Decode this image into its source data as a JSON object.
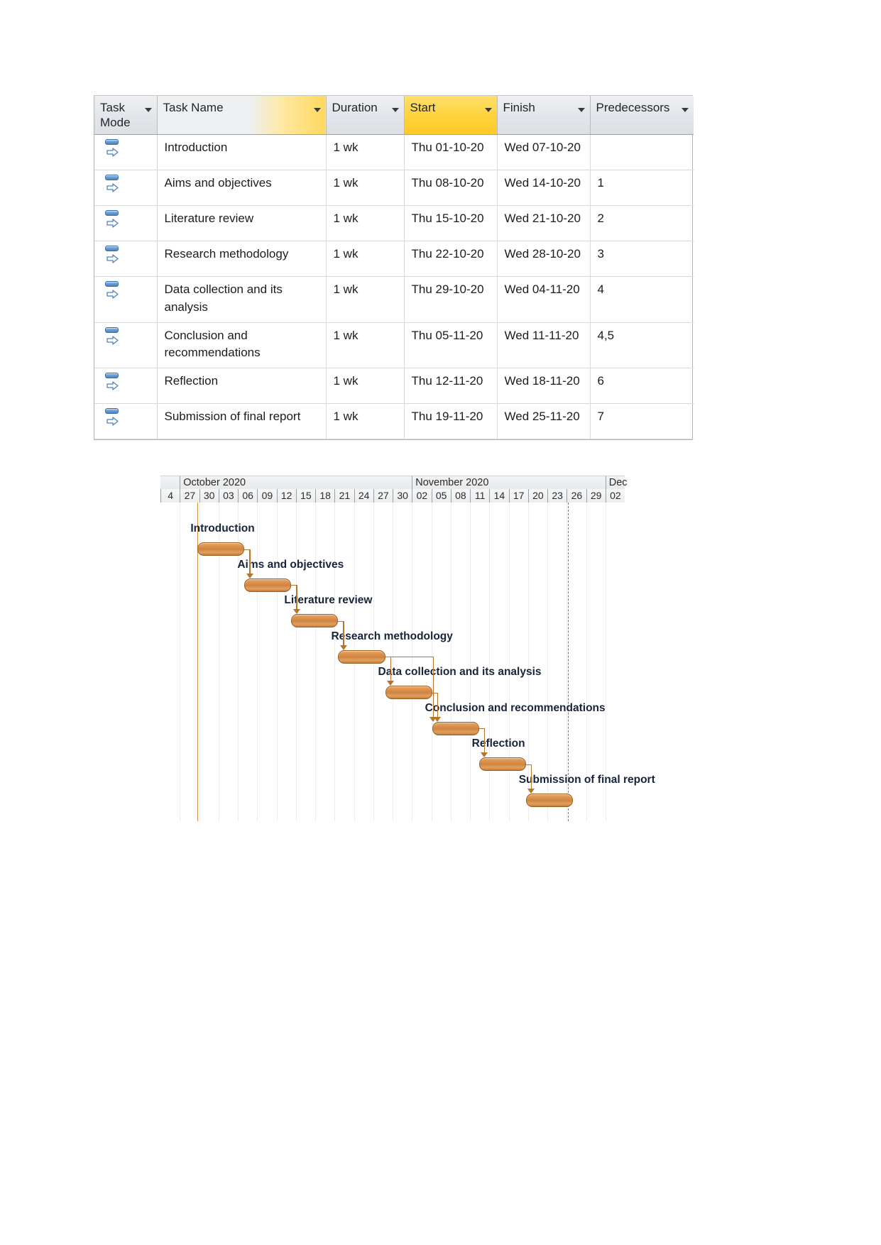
{
  "table": {
    "columns": [
      {
        "key": "mode",
        "label": "Task\nMode",
        "label_line1": "Task",
        "label_line2": "Mode",
        "highlighted": false
      },
      {
        "key": "name",
        "label": "Task Name",
        "highlighted": false
      },
      {
        "key": "dur",
        "label": "Duration",
        "highlighted": false
      },
      {
        "key": "start",
        "label": "Start",
        "highlighted": true
      },
      {
        "key": "finish",
        "label": "Finish",
        "highlighted": false
      },
      {
        "key": "pred",
        "label": "Predecessors",
        "highlighted": false
      }
    ],
    "rows": [
      {
        "id": 1,
        "mode_icon": "auto-schedule-icon",
        "name": "Introduction",
        "duration": "1 wk",
        "start": "Thu 01-10-20",
        "finish": "Wed 07-10-20",
        "predecessors": ""
      },
      {
        "id": 2,
        "mode_icon": "auto-schedule-icon",
        "name": "Aims and objectives",
        "duration": "1 wk",
        "start": "Thu 08-10-20",
        "finish": "Wed 14-10-20",
        "predecessors": "1"
      },
      {
        "id": 3,
        "mode_icon": "auto-schedule-icon",
        "name": "Literature review",
        "duration": "1 wk",
        "start": "Thu 15-10-20",
        "finish": "Wed 21-10-20",
        "predecessors": "2"
      },
      {
        "id": 4,
        "mode_icon": "auto-schedule-icon",
        "name": "Research methodology",
        "duration": "1 wk",
        "start": "Thu 22-10-20",
        "finish": "Wed 28-10-20",
        "predecessors": "3"
      },
      {
        "id": 5,
        "mode_icon": "auto-schedule-icon",
        "name": "Data collection and its analysis",
        "duration": "1 wk",
        "start": "Thu 29-10-20",
        "finish": "Wed 04-11-20",
        "predecessors": "4"
      },
      {
        "id": 6,
        "mode_icon": "auto-schedule-icon",
        "name": "Conclusion and recommendations",
        "duration": "1 wk",
        "start": "Thu 05-11-20",
        "finish": "Wed 11-11-20",
        "predecessors": "4,5"
      },
      {
        "id": 7,
        "mode_icon": "auto-schedule-icon",
        "name": "Reflection",
        "duration": "1 wk",
        "start": "Thu 12-11-20",
        "finish": "Wed 18-11-20",
        "predecessors": "6"
      },
      {
        "id": 8,
        "mode_icon": "auto-schedule-icon",
        "name": "Submission of final report",
        "duration": "1 wk",
        "start": "Thu 19-11-20",
        "finish": "Wed 25-11-20",
        "predecessors": "7"
      }
    ]
  },
  "chart_data": {
    "type": "bar",
    "subtype": "gantt",
    "title": "",
    "xlabel": "",
    "ylabel": "",
    "timescale": {
      "top_tier": [
        {
          "label": "October 2020",
          "start_day": "27",
          "span_ticks": 12
        },
        {
          "label": "November 2020",
          "start_day": "02",
          "span_ticks": 10
        },
        {
          "label": "Dec",
          "start_day": "29",
          "span_ticks": 2
        }
      ],
      "bottom_tier": [
        "4",
        "27",
        "30",
        "03",
        "06",
        "09",
        "12",
        "15",
        "18",
        "21",
        "24",
        "27",
        "30",
        "02",
        "05",
        "08",
        "11",
        "14",
        "17",
        "20",
        "23",
        "26",
        "29",
        "02"
      ],
      "tick_interval_days": 3
    },
    "categories": [
      "Introduction",
      "Aims and objectives",
      "Literature review",
      "Research methodology",
      "Data collection and its analysis",
      "Conclusion and recommendations",
      "Reflection",
      "Submission of final report"
    ],
    "bars": [
      {
        "name": "Introduction",
        "start": "Thu 01-10-20",
        "finish": "Wed 07-10-20",
        "duration": "1 wk",
        "x_pct": 8.0,
        "w_pct": 10.1,
        "row": 0
      },
      {
        "name": "Aims and objectives",
        "start": "Thu 08-10-20",
        "finish": "Wed 14-10-20",
        "duration": "1 wk",
        "x_pct": 18.1,
        "w_pct": 10.1,
        "row": 1
      },
      {
        "name": "Literature review",
        "start": "Thu 15-10-20",
        "finish": "Wed 21-10-20",
        "duration": "1 wk",
        "x_pct": 28.2,
        "w_pct": 10.1,
        "row": 2
      },
      {
        "name": "Research methodology",
        "start": "Thu 22-10-20",
        "finish": "Wed 28-10-20",
        "duration": "1 wk",
        "x_pct": 38.3,
        "w_pct": 10.1,
        "row": 3
      },
      {
        "name": "Data collection and its analysis",
        "start": "Thu 29-10-20",
        "finish": "Wed 04-11-20",
        "duration": "1 wk",
        "x_pct": 48.4,
        "w_pct": 10.1,
        "row": 4
      },
      {
        "name": "Conclusion and recommendations",
        "start": "Thu 05-11-20",
        "finish": "Wed 11-11-20",
        "duration": "1 wk",
        "x_pct": 58.5,
        "w_pct": 10.1,
        "row": 5
      },
      {
        "name": "Reflection",
        "start": "Thu 12-11-20",
        "finish": "Wed 18-11-20",
        "duration": "1 wk",
        "x_pct": 68.6,
        "w_pct": 10.1,
        "row": 6
      },
      {
        "name": "Submission of final report",
        "start": "Thu 19-11-20",
        "finish": "Wed 25-11-20",
        "duration": "1 wk",
        "x_pct": 78.7,
        "w_pct": 10.1,
        "row": 7
      }
    ],
    "links": [
      {
        "from": "Introduction",
        "to": "Aims and objectives",
        "type": "FS"
      },
      {
        "from": "Aims and objectives",
        "to": "Literature review",
        "type": "FS"
      },
      {
        "from": "Literature review",
        "to": "Research methodology",
        "type": "FS"
      },
      {
        "from": "Research methodology",
        "to": "Data collection and its analysis",
        "type": "FS"
      },
      {
        "from": "Data collection and its analysis",
        "to": "Conclusion and recommendations",
        "type": "FS"
      },
      {
        "from": "Research methodology",
        "to": "Conclusion and recommendations",
        "type": "FS"
      },
      {
        "from": "Conclusion and recommendations",
        "to": "Reflection",
        "type": "FS"
      },
      {
        "from": "Reflection",
        "to": "Submission of final report",
        "type": "FS"
      }
    ],
    "grid": true,
    "legend": "none"
  },
  "colors": {
    "bar_fill": "#d8904c",
    "bar_border": "#9a5f22",
    "link_line": "#b5752a",
    "header_highlight": "#ffd23c",
    "header_background": "#e2e5e9",
    "project_start_line": "#c8923c",
    "status_line": "#7a7a7a",
    "label_text": "#17243a",
    "mode_icon": "#4d82bd"
  }
}
